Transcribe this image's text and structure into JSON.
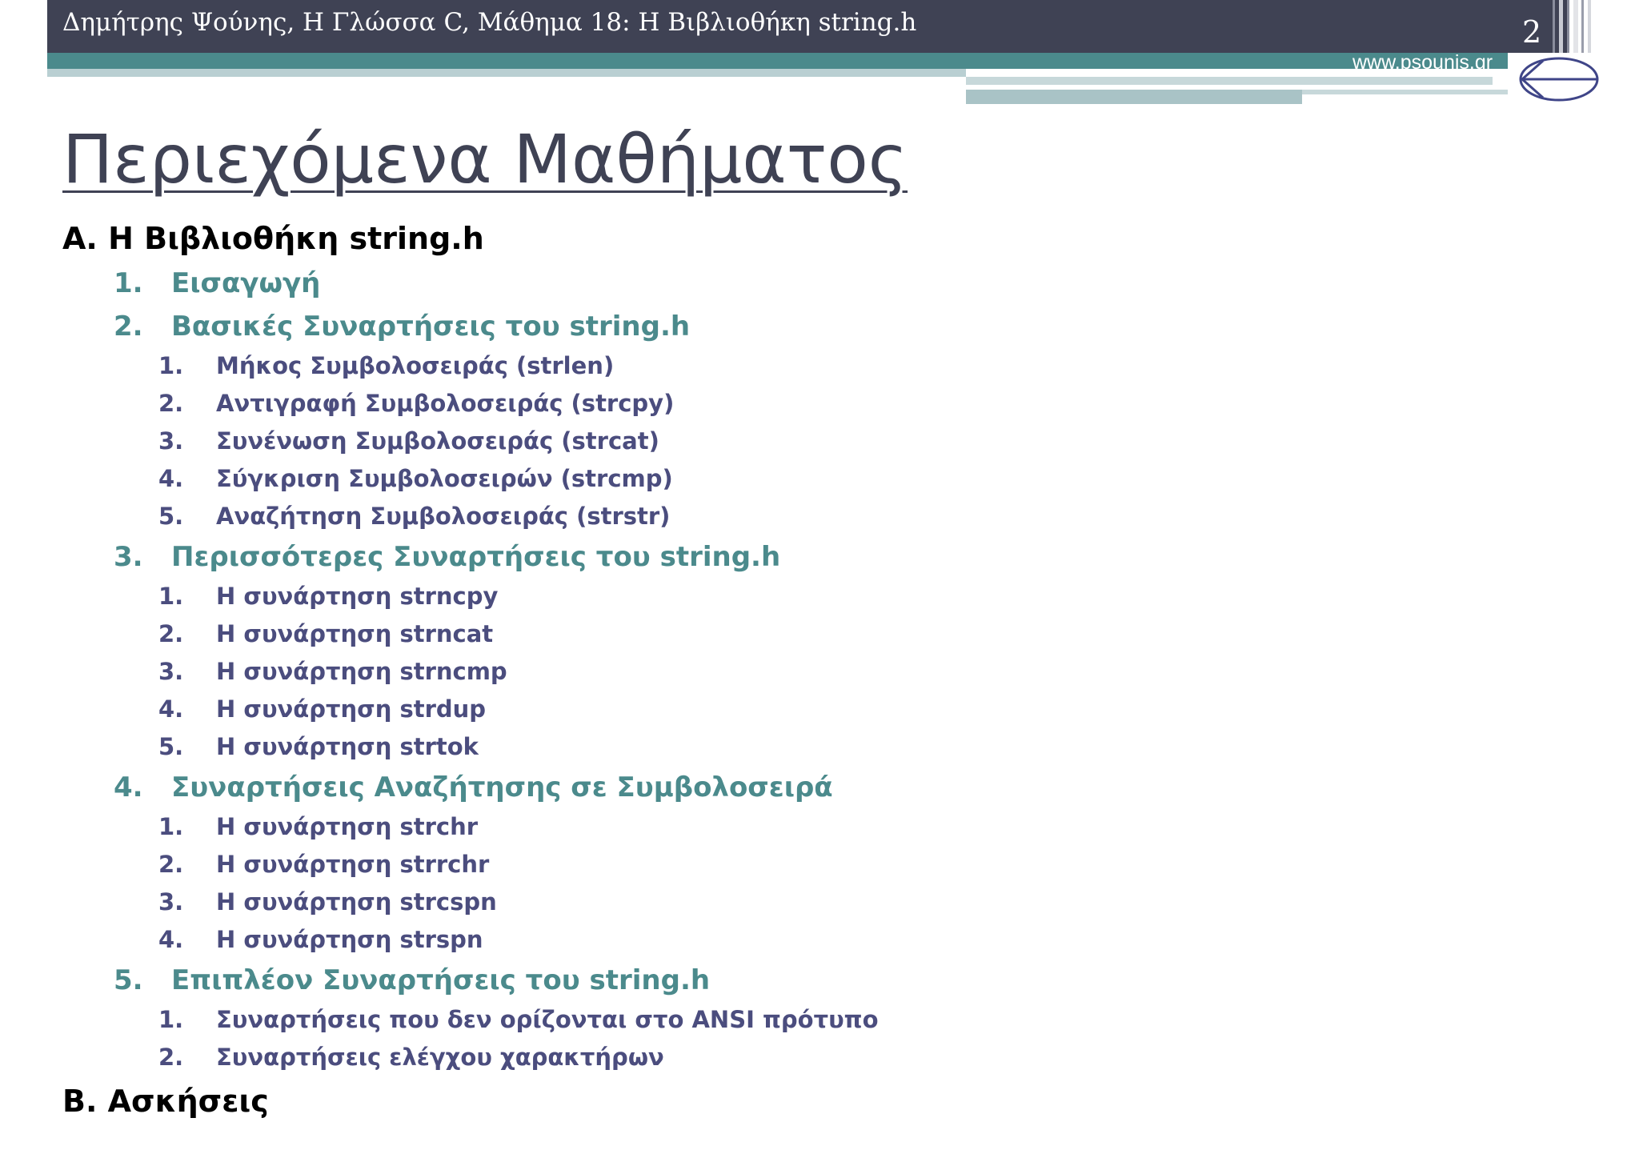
{
  "header": {
    "text": "Δημήτρης Ψούνης, Η Γλώσσα C, Μάθημα 18: Η Βιβλιοθήκη string.h",
    "slide_number": "2",
    "website": "www.psounis.gr"
  },
  "title": "Περιεχόμενα Μαθήματος",
  "sections": {
    "a": {
      "label": "Α. Η Βιβλιοθήκη string.h"
    },
    "b": {
      "label": "Β. Ασκήσεις"
    }
  },
  "items": [
    {
      "num": "1.",
      "text": "Εισαγωγή"
    },
    {
      "num": "2.",
      "text": "Βασικές Συναρτήσεις του string.h"
    },
    {
      "num": "1.",
      "text": "Μήκος Συμβολοσειράς (strlen)"
    },
    {
      "num": "2.",
      "text": "Αντιγραφή Συμβολοσειράς (strcpy)"
    },
    {
      "num": "3.",
      "text": "Συνένωση Συμβολοσειράς (strcat)"
    },
    {
      "num": "4.",
      "text": "Σύγκριση Συμβολοσειρών (strcmp)"
    },
    {
      "num": "5.",
      "text": "Αναζήτηση Συμβολοσειράς (strstr)"
    },
    {
      "num": "3.",
      "text": "Περισσότερες Συναρτήσεις του string.h"
    },
    {
      "num": "1.",
      "text": "Η συνάρτηση strncpy"
    },
    {
      "num": "2.",
      "text": "Η συνάρτηση strncat"
    },
    {
      "num": "3.",
      "text": "Η συνάρτηση strncmp"
    },
    {
      "num": "4.",
      "text": "Η συνάρτηση strdup"
    },
    {
      "num": "5.",
      "text": "Η συνάρτηση strtok"
    },
    {
      "num": "4.",
      "text": "Συναρτήσεις Αναζήτησης σε Συμβολοσειρά"
    },
    {
      "num": "1.",
      "text": "Η συνάρτηση strchr"
    },
    {
      "num": "2.",
      "text": "Η συνάρτηση strrchr"
    },
    {
      "num": "3.",
      "text": "Η συνάρτηση strcspn"
    },
    {
      "num": "4.",
      "text": "Η συνάρτηση strspn"
    },
    {
      "num": "5.",
      "text": "Επιπλέον Συναρτήσεις του string.h"
    },
    {
      "num": "1.",
      "text": "Συναρτήσεις που δεν ορίζονται στο ANSI πρότυπο"
    },
    {
      "num": "2.",
      "text": "Συναρτήσεις ελέγχου χαρακτήρων"
    }
  ]
}
